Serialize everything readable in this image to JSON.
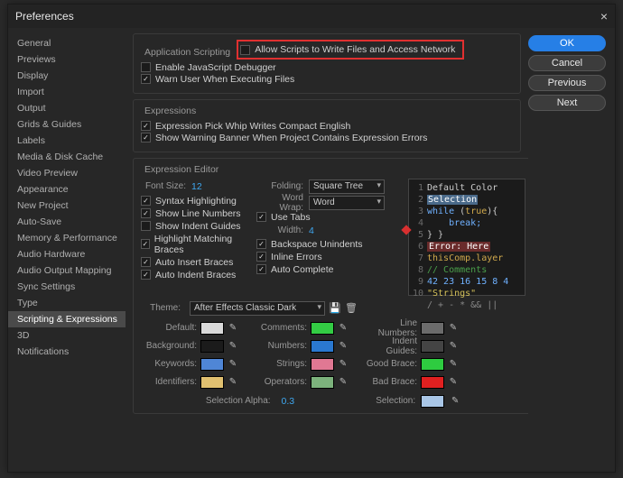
{
  "title": "Preferences",
  "sidebar": {
    "items": [
      {
        "label": "General"
      },
      {
        "label": "Previews"
      },
      {
        "label": "Display"
      },
      {
        "label": "Import"
      },
      {
        "label": "Output"
      },
      {
        "label": "Grids & Guides"
      },
      {
        "label": "Labels"
      },
      {
        "label": "Media & Disk Cache"
      },
      {
        "label": "Video Preview"
      },
      {
        "label": "Appearance"
      },
      {
        "label": "New Project"
      },
      {
        "label": "Auto-Save"
      },
      {
        "label": "Memory & Performance"
      },
      {
        "label": "Audio Hardware"
      },
      {
        "label": "Audio Output Mapping"
      },
      {
        "label": "Sync Settings"
      },
      {
        "label": "Type"
      },
      {
        "label": "Scripting & Expressions"
      },
      {
        "label": "3D"
      },
      {
        "label": "Notifications"
      }
    ],
    "selected_index": 17
  },
  "buttons": {
    "ok": "OK",
    "cancel": "Cancel",
    "previous": "Previous",
    "next": "Next"
  },
  "app_scripting": {
    "legend": "Application Scripting",
    "allow_write": "Allow Scripts to Write Files and Access Network",
    "enable_debug": "Enable JavaScript Debugger",
    "warn_exec": "Warn User When Executing Files"
  },
  "expressions": {
    "legend": "Expressions",
    "pick_whip": "Expression Pick Whip Writes Compact English",
    "warn_banner": "Show Warning Banner When Project Contains Expression Errors"
  },
  "editor": {
    "legend": "Expression Editor",
    "font_size_label": "Font Size:",
    "font_size": "12",
    "folding_label": "Folding:",
    "folding": "Square Tree",
    "word_wrap_label": "Word Wrap:",
    "word_wrap": "Word",
    "use_tabs": "Use Tabs",
    "width_label": "Width:",
    "width": "4",
    "syntax": "Syntax Highlighting",
    "line_numbers": "Show Line Numbers",
    "indent_guides": "Show Indent Guides",
    "match_braces": "Highlight Matching Braces",
    "auto_insert": "Auto Insert Braces",
    "auto_indent": "Auto Indent Braces",
    "back_unindent": "Backspace Unindents",
    "inline_errors": "Inline Errors",
    "auto_complete": "Auto Complete",
    "code": {
      "l1": "Default Color",
      "l2": "Selection",
      "l3a": "while",
      "l3b": "(",
      "l3c": "true",
      "l3d": "){",
      "l4": "break;",
      "l5": "} }",
      "l6": "Error: Here",
      "l7": "thisComp.layer",
      "l8": "// Comments",
      "l9": "42 23 16 15 8 4",
      "l10": "\"Strings\"",
      "l11": "/ + - * && ||"
    }
  },
  "theme": {
    "label": "Theme:",
    "value": "After Effects Classic Dark",
    "rows": {
      "default": "Default:",
      "background": "Background:",
      "keywords": "Keywords:",
      "identifiers": "Identifiers:",
      "comments": "Comments:",
      "numbers": "Numbers:",
      "strings": "Strings:",
      "operators": "Operators:",
      "line_numbers": "Line Numbers:",
      "indent_guides": "Indent Guides:",
      "good_brace": "Good Brace:",
      "bad_brace": "Bad Brace:",
      "selection": "Selection:"
    },
    "colors": {
      "default": "#d9d9d9",
      "background": "#1b1b1b",
      "keywords": "#4f86d6",
      "identifiers": "#e0c070",
      "comments": "#33cc44",
      "numbers": "#2a78d0",
      "strings": "#e07893",
      "operators": "#7cb27c",
      "line_numbers": "#6b6b6b",
      "indent_guides": "#444444",
      "good_brace": "#2ecc40",
      "bad_brace": "#e02020",
      "selection": "#a9c6e6"
    },
    "sel_alpha_label": "Selection Alpha:",
    "sel_alpha": "0.3"
  }
}
